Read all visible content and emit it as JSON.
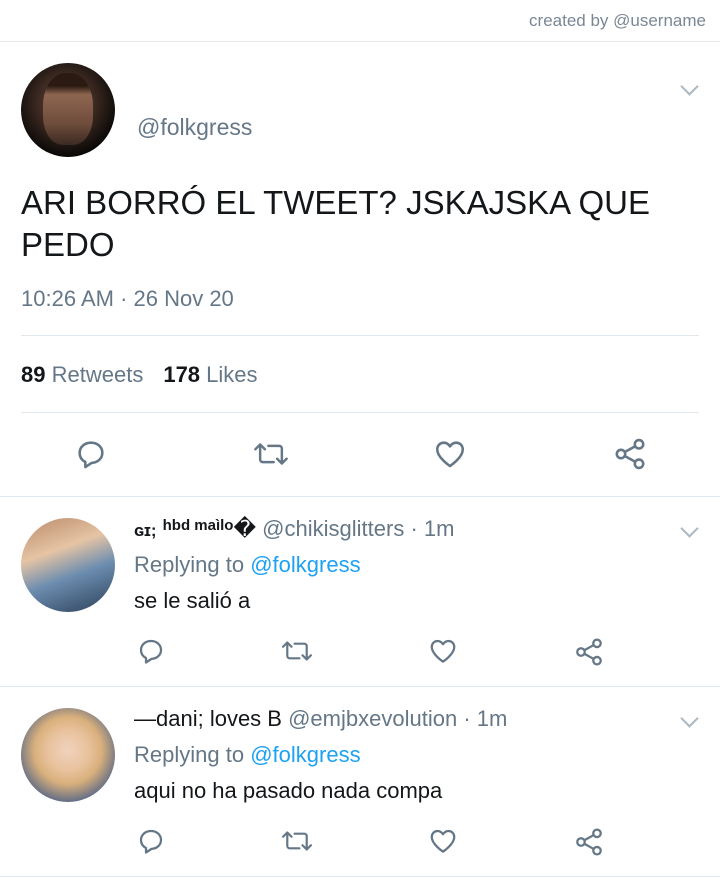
{
  "header": {
    "credit": "created by @username"
  },
  "main_tweet": {
    "handle": "@folkgress",
    "text": "ARI BORRÓ EL TWEET? JSKAJSKA QUE PEDO",
    "timestamp": "10:26 AM · 26 Nov 20",
    "retweets_count": "89",
    "retweets_label": "Retweets",
    "likes_count": "178",
    "likes_label": "Likes"
  },
  "replies": [
    {
      "name_prefix": "ɢɪ;",
      "name_small": "hbd maìlo",
      "name_glyph": "�",
      "handle": "@chikisglitters",
      "time": "· 1m",
      "replying_label": "Replying to",
      "replying_to": "@folkgress",
      "text": "se le salió a"
    },
    {
      "name": "—dani; loves B",
      "handle": "@emjbxevolution",
      "time": "· 1m",
      "replying_label": "Replying to",
      "replying_to": "@folkgress",
      "text": "aqui no ha pasado nada compa"
    }
  ],
  "icons": [
    "reply-icon",
    "retweet-icon",
    "like-icon",
    "share-icon",
    "chevron-down-icon"
  ],
  "colors": {
    "link": "#1da1f2",
    "muted": "#657786",
    "icon": "#657786",
    "divider": "#e1e8ed"
  }
}
